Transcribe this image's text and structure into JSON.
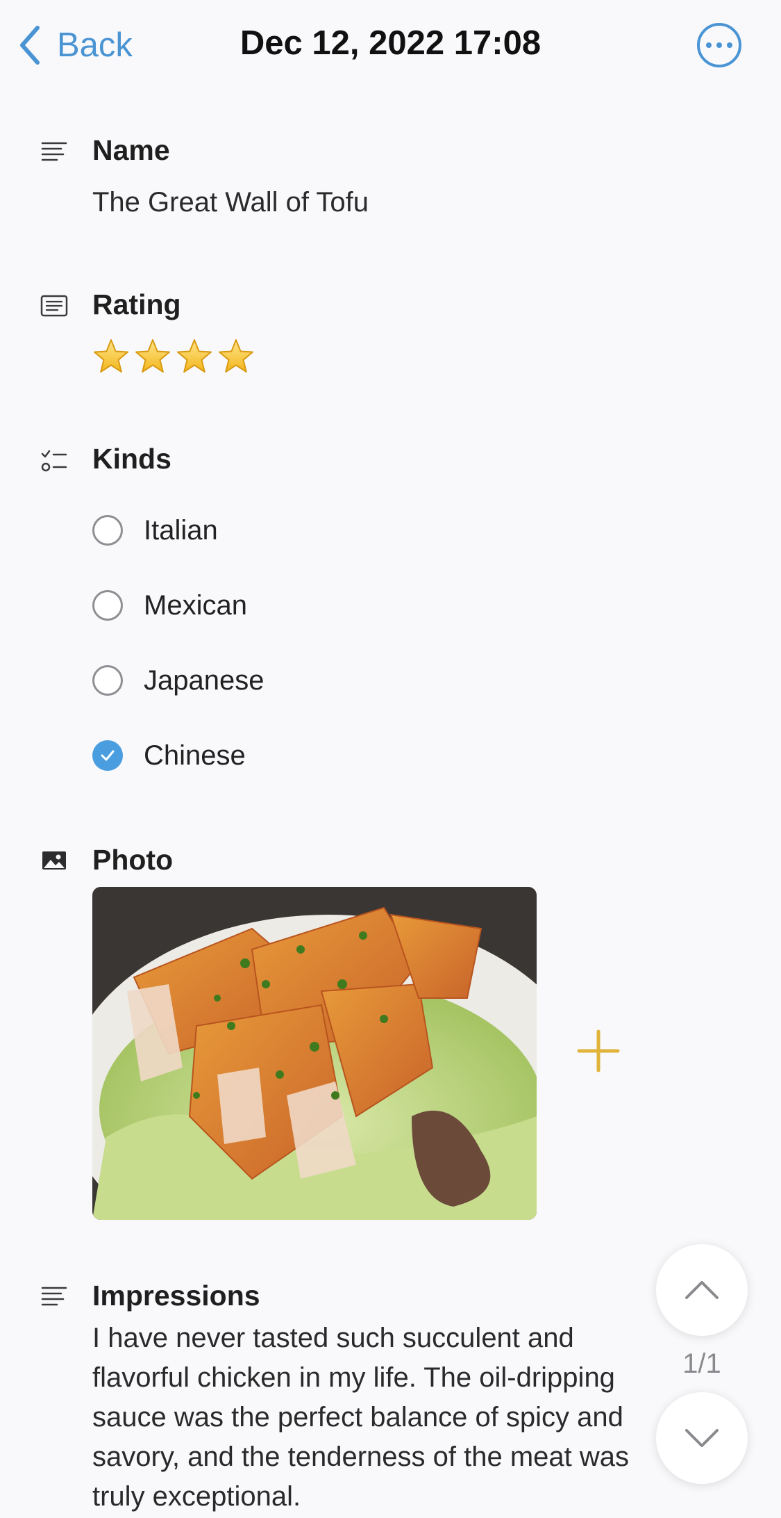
{
  "header": {
    "back_label": "Back",
    "title": "Dec 12, 2022 17:08",
    "accent_color": "#4a94d4"
  },
  "fields": {
    "name": {
      "label": "Name",
      "value": "The Great Wall of Tofu"
    },
    "rating": {
      "label": "Rating",
      "stars": 4
    },
    "kinds": {
      "label": "Kinds",
      "options": [
        {
          "label": "Italian",
          "checked": false
        },
        {
          "label": "Mexican",
          "checked": false
        },
        {
          "label": "Japanese",
          "checked": false
        },
        {
          "label": "Chinese",
          "checked": true
        }
      ]
    },
    "photo": {
      "label": "Photo"
    },
    "impressions": {
      "label": "Impressions",
      "text": "I have never tasted such succulent and flavorful chicken in my life. The oil-dripping sauce was the perfect balance of spicy and savory, and the tenderness of the meat was truly exceptional."
    }
  },
  "pager": {
    "count": "1/1"
  },
  "icons": [
    "chevron-left-icon",
    "more-icon",
    "text-lines-icon",
    "list-box-icon",
    "checklist-icon",
    "image-icon",
    "star-icon",
    "check-icon",
    "plus-icon",
    "chevron-up-icon",
    "chevron-down-icon"
  ]
}
